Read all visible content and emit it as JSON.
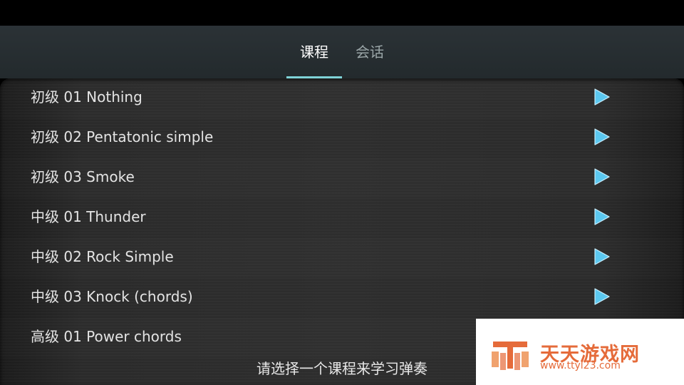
{
  "tabs": [
    {
      "label": "课程",
      "active": true
    },
    {
      "label": "会话",
      "active": false
    }
  ],
  "lessons": [
    {
      "label": "初级 01 Nothing"
    },
    {
      "label": "初级 02 Pentatonic simple"
    },
    {
      "label": "初级 03 Smoke"
    },
    {
      "label": "中级 01 Thunder"
    },
    {
      "label": "中级 02 Rock Simple"
    },
    {
      "label": "中级 03 Knock (chords)"
    },
    {
      "label": "高级 01 Power chords"
    }
  ],
  "footer": {
    "hint": "请选择一个课程来学习弹奏"
  },
  "watermark": {
    "title": "天天游戏网",
    "url": "www.ttyl23.com"
  },
  "colors": {
    "accent": "#7fd3d8",
    "play": "#5bc8f0",
    "watermark": "#e56b3a"
  },
  "icons": {
    "row_action": "play-icon"
  }
}
